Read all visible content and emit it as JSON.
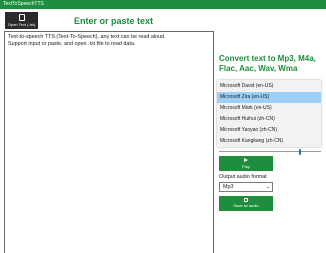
{
  "window": {
    "title": "TextToSpeechTTS"
  },
  "toolbar": {
    "open_label": "Open Text (.txt)"
  },
  "header": {
    "title": "Enter or paste text"
  },
  "editor": {
    "text": "Text-to-speech TTS (Text-To-Speech), any text can be read aloud.\nSupport input or paste, and open .txt file to read data."
  },
  "convert": {
    "heading": "Convert text to Mp3, M4a, Flac, Aac, Wav, Wma"
  },
  "voices": {
    "items": [
      "Microsoft David (en-US)",
      "Microsoft Zira (en-US)",
      "Microsoft Mark (en-US)",
      "Microsoft Huihui (zh-CN)",
      "Microsoft Yaoyao (zh-CN)",
      "Microsoft Kangkang (zh-CN)"
    ],
    "selected_index": 1
  },
  "speed_slider": {
    "value": 0.8
  },
  "controls": {
    "play_label": "Play",
    "format_label": "Output audio format",
    "format_value": "Mp3",
    "save_label": "Save as audio"
  },
  "colors": {
    "accent": "#1e8d3d",
    "selection": "#9ecff4",
    "toolbar_button": "#2b2b2b"
  }
}
